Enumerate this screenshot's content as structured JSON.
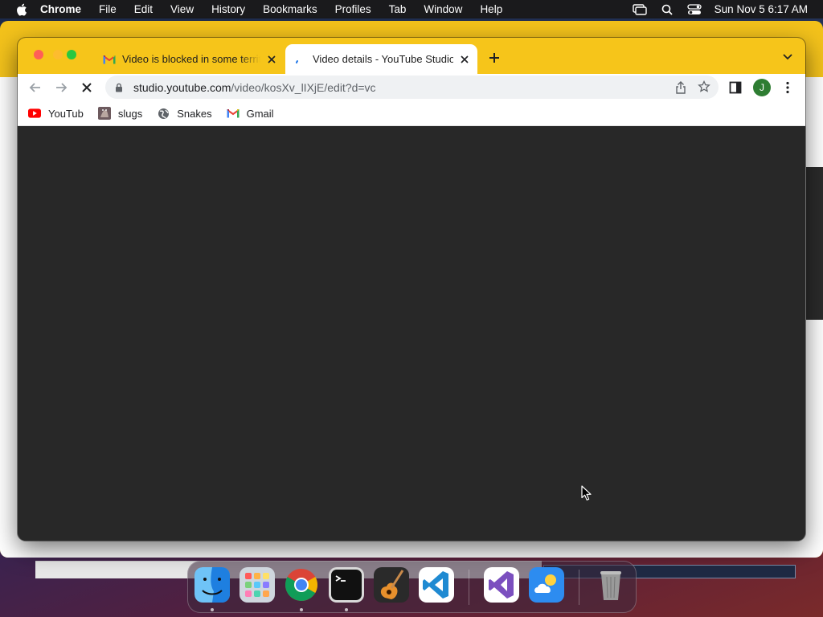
{
  "menubar": {
    "app_name": "Chrome",
    "menus": [
      "File",
      "Edit",
      "View",
      "History",
      "Bookmarks",
      "Profiles",
      "Tab",
      "Window",
      "Help"
    ],
    "clock": "Sun Nov 5  6:17 AM"
  },
  "browser": {
    "tabs": [
      {
        "title": "Video is blocked in some territ",
        "favicon": "gmail-icon",
        "active": false
      },
      {
        "title": "Video details - YouTube Studio",
        "favicon": "loading-icon",
        "active": true
      }
    ],
    "url_host": "studio.youtube.com",
    "url_path": "/video/kosXv_lIXjE/edit?d=vc",
    "profile_initial": "J",
    "bookmarks": [
      {
        "label": "YouTub",
        "icon": "youtube-icon"
      },
      {
        "label": "slugs",
        "icon": "slug-image-icon"
      },
      {
        "label": "Snakes",
        "icon": "globe-icon"
      },
      {
        "label": "Gmail",
        "icon": "gmail-icon"
      }
    ]
  },
  "dock": {
    "apps": [
      "finder-icon",
      "launchpad-icon",
      "chrome-icon",
      "terminal-icon",
      "garageband-icon",
      "vscode-icon",
      "visual-studio-icon",
      "weather-icon",
      "trash-icon"
    ]
  },
  "colors": {
    "tab_strip": "#f6c51a",
    "content_bg": "#282828",
    "avatar_bg": "#2e7d32"
  }
}
